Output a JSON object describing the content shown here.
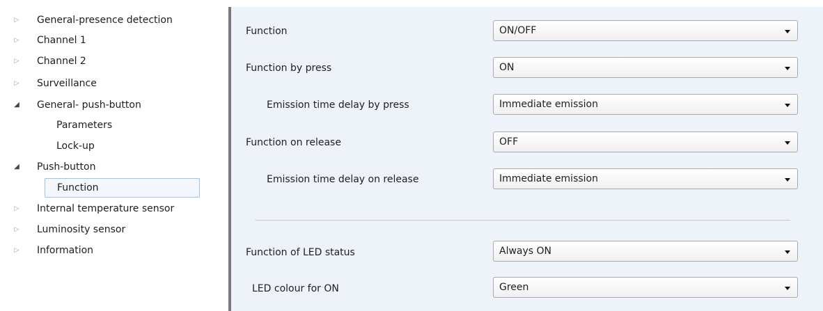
{
  "sidebar": {
    "items": [
      {
        "label": "General-presence detection",
        "icon": "collapsed-arrow-icon"
      },
      {
        "label": "Channel 1",
        "icon": "collapsed-arrow-icon"
      },
      {
        "label": "Channel 2",
        "icon": "collapsed-arrow-icon"
      },
      {
        "label": "Surveillance",
        "icon": "collapsed-arrow-icon"
      },
      {
        "label": "General- push-button",
        "icon": "expanded-arrow-icon"
      },
      {
        "label": "Parameters"
      },
      {
        "label": "Lock-up"
      },
      {
        "label": "Push-button",
        "icon": "expanded-arrow-icon"
      },
      {
        "label": "Function",
        "selected": true
      },
      {
        "label": "Internal temperature sensor",
        "icon": "collapsed-arrow-icon"
      },
      {
        "label": "Luminosity sensor",
        "icon": "collapsed-arrow-icon"
      },
      {
        "label": "Information",
        "icon": "collapsed-arrow-icon"
      }
    ]
  },
  "main": {
    "params": [
      {
        "label": "Function",
        "value": "ON/OFF"
      },
      {
        "label": "Function by press",
        "value": "ON"
      },
      {
        "label": "Emission time delay by press",
        "value": "Immediate emission"
      },
      {
        "label": "Function on release",
        "value": "OFF"
      },
      {
        "label": "Emission time delay on release",
        "value": "Immediate emission"
      },
      {
        "label": "Function of LED status",
        "value": "Always ON"
      },
      {
        "label": "LED colour for ON",
        "value": "Green"
      }
    ]
  },
  "colors": {
    "panel_background": "#eef3fa",
    "selection_border": "#9ec3ea",
    "splitter": "#7a7a7a"
  }
}
